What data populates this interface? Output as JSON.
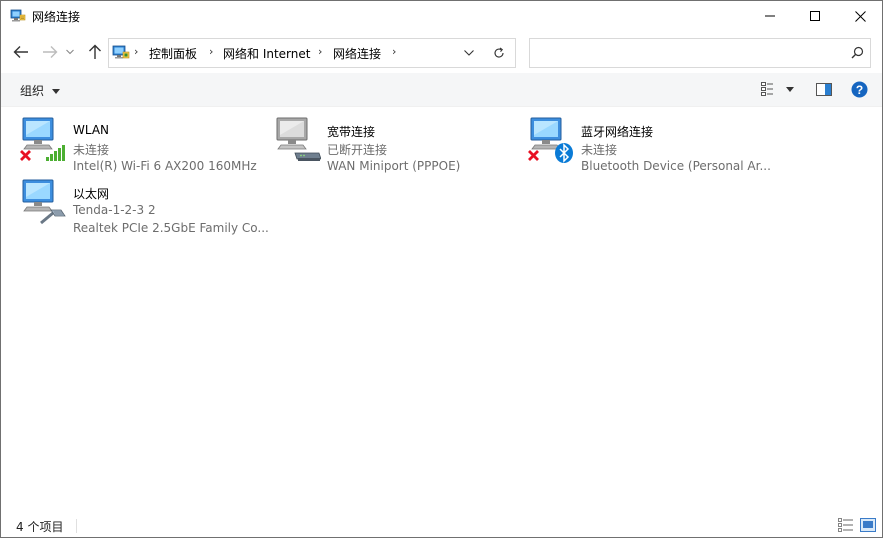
{
  "window": {
    "title": "网络连接",
    "minimize_icon": "minimize-icon",
    "maximize_icon": "maximize-icon",
    "close_icon": "close-icon"
  },
  "navigation": {
    "back_icon": "arrow-left-icon",
    "forward_icon": "arrow-right-icon",
    "recent_icon": "chevron-down-icon",
    "up_icon": "arrow-up-icon"
  },
  "address": {
    "breadcrumbs": [
      "控制面板",
      "网络和 Internet",
      "网络连接"
    ],
    "refresh_icon": "refresh-icon"
  },
  "search": {
    "placeholder": "",
    "icon": "search-icon"
  },
  "toolbar": {
    "organize_label": "组织",
    "view_icon": "view-options-icon",
    "preview_icon": "preview-pane-icon",
    "help_icon": "help-icon"
  },
  "connections": [
    {
      "name": "WLAN",
      "status": "未连接",
      "device": "Intel(R) Wi-Fi 6 AX200 160MHz",
      "overlay": "wifi-signal",
      "disconnected": true
    },
    {
      "name": "宽带连接",
      "status": "已断开连接",
      "device": "WAN Miniport (PPPOE)",
      "overlay": "modem",
      "disconnected": false
    },
    {
      "name": "蓝牙网络连接",
      "status": "未连接",
      "device": "Bluetooth Device (Personal Ar...",
      "overlay": "bluetooth",
      "disconnected": true
    },
    {
      "name": "以太网",
      "status": "Tenda-1-2-3 2",
      "device": "Realtek PCIe 2.5GbE Family Co...",
      "overlay": "ethernet-cable",
      "disconnected": false
    }
  ],
  "statusbar": {
    "item_count": "4 个项目"
  },
  "colors": {
    "accent": "#0063b1",
    "disconnect_red": "#e81123",
    "bluetooth_blue": "#0a7bd6",
    "signal_green": "#4caf32"
  }
}
